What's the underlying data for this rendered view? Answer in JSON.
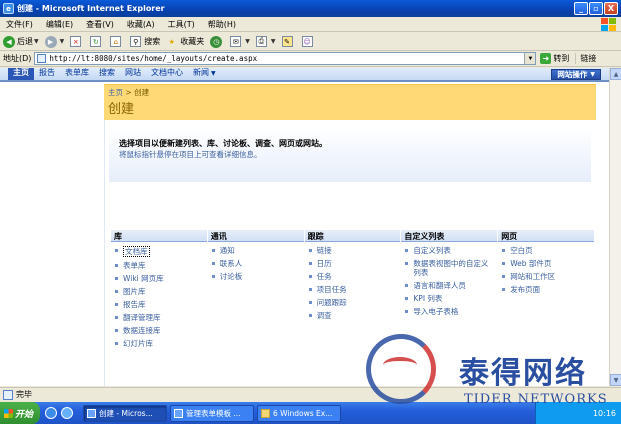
{
  "window": {
    "title": "创建 - Microsoft Internet Explorer",
    "minimize": "_",
    "maximize": "▫",
    "close": "X"
  },
  "menu": [
    "文件(F)",
    "编辑(E)",
    "查看(V)",
    "收藏(A)",
    "工具(T)",
    "帮助(H)"
  ],
  "toolbar": {
    "back": "后退",
    "search": "搜索",
    "favorites": "收藏夹"
  },
  "address": {
    "label": "地址(D)",
    "url": "http://lt:8080/sites/home/_layouts/create.aspx",
    "go": "转到",
    "links": "链接"
  },
  "sharepoint": {
    "tabs": [
      "主页",
      "报告",
      "表单库",
      "搜索",
      "网站",
      "文档中心",
      "新闻"
    ],
    "site_actions": "网站操作",
    "breadcrumb_home": "主页",
    "breadcrumb_sep": ">",
    "breadcrumb_current": "创建",
    "page_title": "创建",
    "intro_strong": "选择项目以便新建列表、库、讨论板、调查、网页或网站。",
    "intro_sub": "将鼠标指针悬停在项目上可查看详细信息。"
  },
  "columns": [
    {
      "header": "库",
      "items": [
        "文档库",
        "表单库",
        "Wiki 网页库",
        "图片库",
        "报告库",
        "翻译管理库",
        "数据连接库",
        "幻灯片库"
      ]
    },
    {
      "header": "通讯",
      "items": [
        "通知",
        "联系人",
        "讨论板"
      ]
    },
    {
      "header": "跟踪",
      "items": [
        "链接",
        "日历",
        "任务",
        "项目任务",
        "问题跟踪",
        "调查"
      ]
    },
    {
      "header": "自定义列表",
      "items": [
        "自定义列表",
        "数据表视图中的自定义列表",
        "语言和翻译人员",
        "KPI 列表",
        "导入电子表格"
      ]
    },
    {
      "header": "网页",
      "items": [
        "空白页",
        "Web 部件页",
        "网站和工作区",
        "发布页面"
      ]
    }
  ],
  "status": "完毕",
  "taskbar": {
    "start": "开始",
    "tasks": [
      "创建 - Micros...",
      "管理表单模板 ...",
      "6 Windows Ex..."
    ],
    "clock": "10:16"
  },
  "watermark": {
    "cn": "泰得网络",
    "en": "TIDER NETWORKS"
  }
}
